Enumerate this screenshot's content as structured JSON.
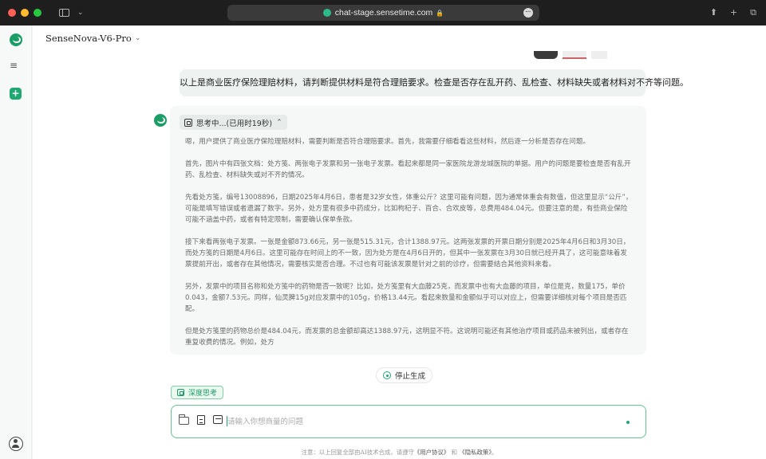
{
  "browser": {
    "url": "chat-stage.sensetime.com"
  },
  "header": {
    "model_name": "SenseNova-V6-Pro"
  },
  "conversation": {
    "user_message": "以上是商业医疗保险理赔材料，请判断提供材料是符合理赔要求。检查是否存在乱开药、乱检查、材料缺失或者材料对不齐等问题。",
    "assistant": {
      "thinking_label": "思考中...(已用时19秒)",
      "paragraphs": [
        "嗯，用户提供了商业医疗保险理赔材料，需要判断是否符合理赔要求。首先，我需要仔细看看这些材料，然后逐一分析是否存在问题。",
        "首先，图片中有四张文档：处方笺、两张电子发票和另一张电子发票。看起来都是同一家医院龙游龙城医院的单据。用户的问题是要检查是否有乱开药、乱检查、材料缺失或对不齐的情况。",
        "先看处方笺，编号13008896，日期2025年4月6日，患者是32岁女性，体重公斤？这里可能有问题，因为通常体重会有数值，但这里显示“公斤”，可能是填写错误或者遗漏了数字。另外，处方里有很多中药成分，比如枸杞子、百合、合欢皮等，总费用484.04元。但要注意的是，有些商业保险可能不涵盖中药，或者有特定限制，需要确认保单条款。",
        "接下来看两张电子发票。一张是金额873.66元，另一张是515.31元，合计1388.97元。这两张发票的开票日期分别是2025年4月6日和3月30日，而处方笺的日期是4月6日。这里可能存在时间上的不一致，因为处方是在4月6日开的，但其中一张发票在3月30日就已经开具了，这可能意味着发票提前开出，或者存在其他情况，需要核实是否合理。不过也有可能该发票是针对之前的诊疗，但需要结合其他资料来看。",
        "另外，发票中的项目名称和处方笺中的药物是否一致呢？比如，处方笺里有大血藤25克，而发票中也有大血藤的项目，单位是克，数量175，单价0.043，金额7.53元。同样，仙灵脾15g对应发票中的105g，价格13.44元。看起来数量和金额似乎可以对应上，但需要详细核对每个项目是否匹配。",
        "但是处方笺里的药物总价是484.04元，而发票的总金额却高达1388.97元，这明显不符。这说明可能还有其他治疗项目或药品未被列出，或者存在重复收费的情况。例如，处方"
      ]
    }
  },
  "controls": {
    "stop_label": "停止生成",
    "deep_think_label": "深度思考",
    "input_placeholder": "请输入你想商量的问题"
  },
  "footer": {
    "disclaimer_prefix": "注意：以上回复全部由AI技术合成，请遵守",
    "user_agreement": "《用户协议》",
    "and": "和",
    "privacy_policy": "《隐私政策》",
    "suffix": "。"
  }
}
